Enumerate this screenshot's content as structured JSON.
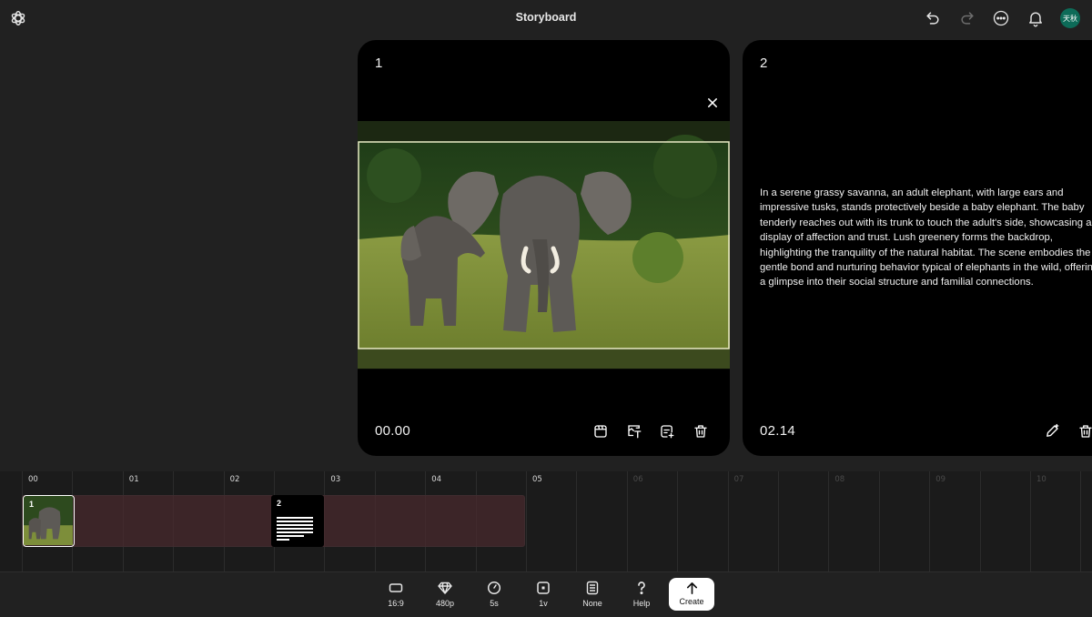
{
  "header": {
    "title": "Storyboard",
    "avatar_text": "天秋",
    "icons": [
      "openai-logo-icon",
      "undo-icon",
      "redo-icon",
      "more-icon",
      "bell-icon"
    ]
  },
  "cards": [
    {
      "number": "1",
      "timestamp": "00.00",
      "image": "adult-elephant-and-baby-elephant-in-grassy-savanna",
      "tools": [
        "media-icon",
        "text-overlay-icon",
        "caption-icon",
        "trash-icon"
      ]
    },
    {
      "number": "2",
      "timestamp": "02.14",
      "description": "In a serene grassy savanna, an adult elephant, with large ears and impressive tusks, stands protectively beside a baby elephant. The baby tenderly reaches out with its trunk to touch the adult's side, showcasing a display of affection and trust. Lush greenery forms the backdrop, highlighting the tranquility of the natural habitat. The scene embodies the gentle bond and nurturing behavior typical of elephants in the wild, offering a glimpse into their social structure and familial connections.",
      "tools": [
        "edit-icon",
        "trash-icon"
      ]
    }
  ],
  "timeline": {
    "ruler": [
      "00",
      "01",
      "02",
      "03",
      "04",
      "05",
      "06",
      "07",
      "08",
      "09",
      "10"
    ],
    "active_until": 5,
    "clips": [
      {
        "label": "1",
        "type": "image"
      },
      {
        "label": "2",
        "type": "text"
      }
    ]
  },
  "toolbar": {
    "items": [
      {
        "label": "16:9",
        "icon": "aspect-ratio-icon"
      },
      {
        "label": "480p",
        "icon": "diamond-icon"
      },
      {
        "label": "5s",
        "icon": "clock-icon"
      },
      {
        "label": "1v",
        "icon": "variations-icon"
      },
      {
        "label": "None",
        "icon": "preset-icon"
      },
      {
        "label": "Help",
        "icon": "help-icon"
      }
    ],
    "create_label": "Create"
  }
}
